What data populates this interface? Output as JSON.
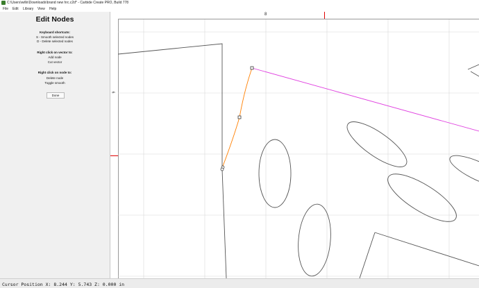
{
  "window": {
    "title": "C:\\Users\\willx\\Downloads\\brand new hrc.c2d* - Carbide Create PRO, Build 778"
  },
  "menu": {
    "items": [
      "File",
      "Edit",
      "Library",
      "View",
      "Help"
    ]
  },
  "sidebar": {
    "title": "Edit Nodes",
    "keyboard_heading": "Keyboard shortcuts:",
    "keyboard_items": [
      "S - Smooth selected nodes",
      "D - Delete selected nodes"
    ],
    "vector_heading": "Right click on vector to:",
    "vector_items": [
      "Add node",
      "Cut vector"
    ],
    "node_heading": "Right click on node to:",
    "node_items": [
      "Delete node",
      "Toggle smooth"
    ],
    "done_label": "Done"
  },
  "rulers": {
    "top_label": "8",
    "left_label": "6"
  },
  "status": {
    "text": "Cursor Position X: 8.244 Y: 5.743 Z: 0.000 in"
  },
  "colors": {
    "selected_segment": "#ff7f00",
    "highlight_segment": "#e040e0",
    "ruler_marker": "#e00000",
    "geometry": "#555555",
    "grid": "#d8d8d8"
  }
}
